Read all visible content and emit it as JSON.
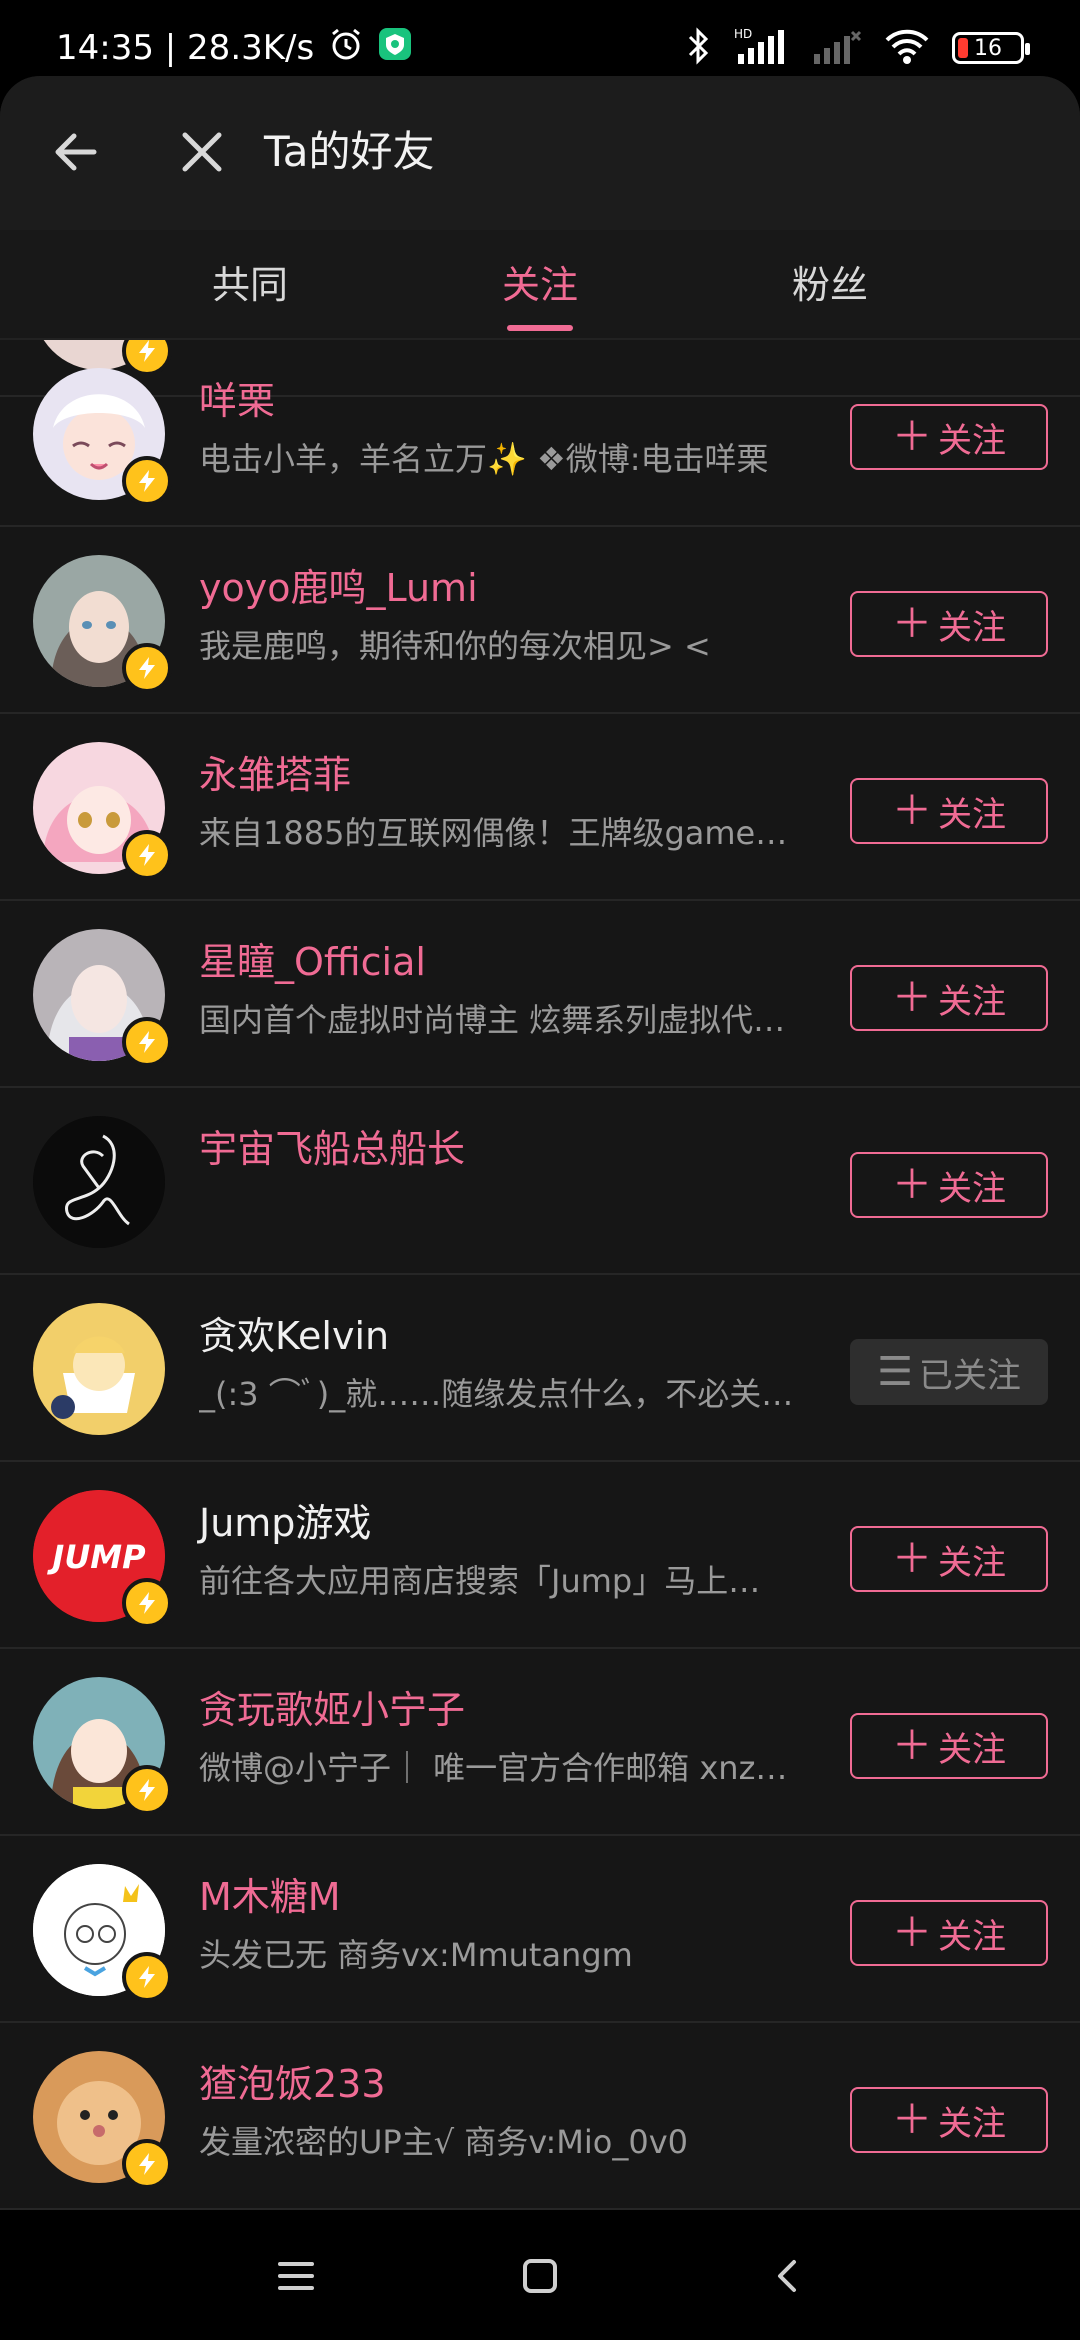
{
  "status_bar": {
    "time_speed": "14:35 | 28.3K/s",
    "battery": "16"
  },
  "header": {
    "title": "Ta的好友"
  },
  "tabs": [
    {
      "label": "共同",
      "active": false
    },
    {
      "label": "关注",
      "active": true
    },
    {
      "label": "粉丝",
      "active": false
    }
  ],
  "follow_label": "关注",
  "followed_label": "已关注",
  "users": [
    {
      "name": "咩栗",
      "desc": "电击小羊，羊名立万✨ ❖微博:电击咩栗",
      "followed": false,
      "verified": true,
      "name_color": "pink"
    },
    {
      "name": "yoyo鹿鸣_Lumi",
      "desc": "我是鹿鸣，期待和你的每次相见> <",
      "followed": false,
      "verified": true,
      "name_color": "pink"
    },
    {
      "name": "永雏塔菲",
      "desc": "来自1885的互联网偶像！王牌级gamer…",
      "followed": false,
      "verified": true,
      "name_color": "pink"
    },
    {
      "name": "星瞳_Official",
      "desc": "国内首个虚拟时尚博主 炫舞系列虚拟代…",
      "followed": false,
      "verified": true,
      "name_color": "pink"
    },
    {
      "name": "宇宙飞船总船长",
      "desc": "",
      "followed": false,
      "verified": false,
      "name_color": "pink"
    },
    {
      "name": "贪欢Kelvin",
      "desc": "_(:3 ⌒ﾞ)_就……随缘发点什么，不必关…",
      "followed": true,
      "verified": false,
      "name_color": "white"
    },
    {
      "name": "Jump游戏",
      "desc": "前往各大应用商店搜索「Jump」马上…",
      "followed": false,
      "verified": true,
      "name_color": "white"
    },
    {
      "name": "贪玩歌姬小宁子",
      "desc": "微博@小宁子｜ 唯一官方合作邮箱 xnz…",
      "followed": false,
      "verified": true,
      "name_color": "pink"
    },
    {
      "name": "M木糖M",
      "desc": "头发已无 商务vx:Mmutangm",
      "followed": false,
      "verified": true,
      "name_color": "pink"
    },
    {
      "name": "猹泡饭233",
      "desc": "发量浓密的UP主√ 商务v:Mio_0v0",
      "followed": false,
      "verified": true,
      "name_color": "pink"
    }
  ],
  "colors": {
    "accent": "#f06b94",
    "background": "#161616",
    "verified_badge": "#ffc21b"
  }
}
